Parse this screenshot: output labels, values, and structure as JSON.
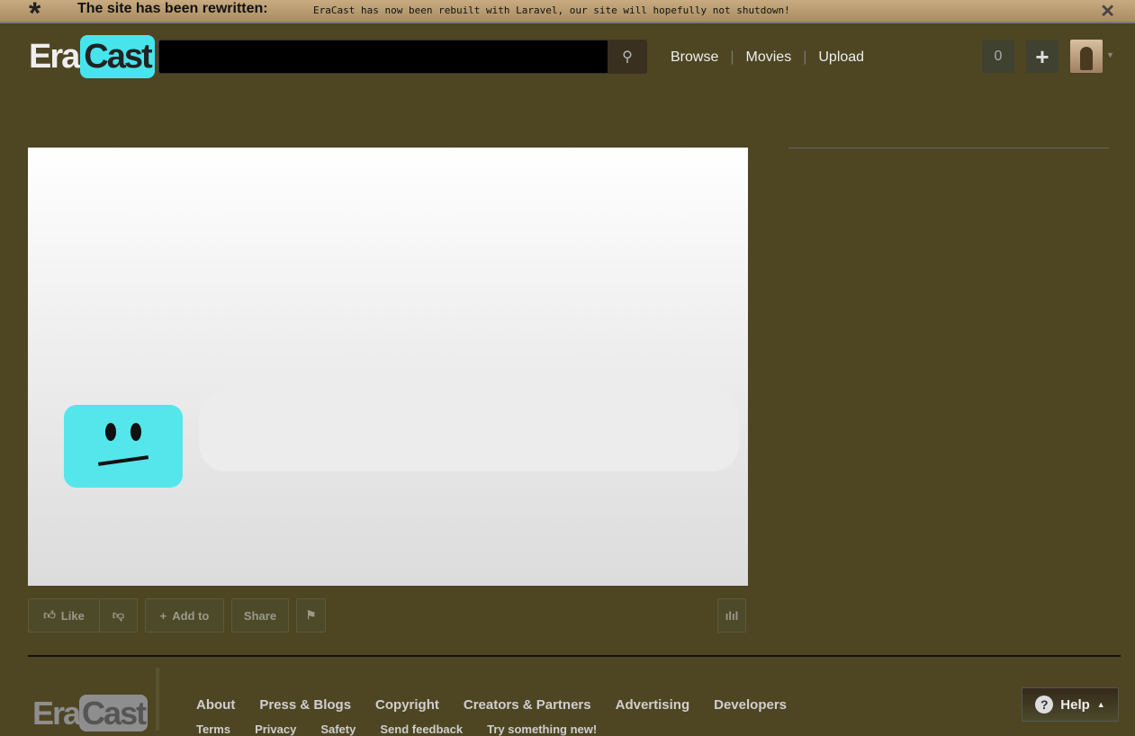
{
  "banner": {
    "title": "The site has been rewritten:",
    "message": "EraCast has now been rebuilt with Laravel, our site will hopefully not shutdown!"
  },
  "header": {
    "logo_left": "Era",
    "logo_right": "Cast",
    "search_placeholder": "",
    "nav": [
      "Browse",
      "Movies",
      "Upload"
    ],
    "notification_count": "0"
  },
  "actions": {
    "like": "Like",
    "add_to": "Add to",
    "share": "Share"
  },
  "footer": {
    "logo_left": "Era",
    "logo_right": "Cast",
    "links": [
      "About",
      "Press & Blogs",
      "Copyright",
      "Creators & Partners",
      "Advertising",
      "Developers"
    ],
    "links2": [
      "Terms",
      "Privacy",
      "Safety",
      "Send feedback",
      "Try something new!"
    ],
    "help": "Help"
  },
  "colors": {
    "brand": "#48e4ec",
    "background": "#4e4523"
  }
}
